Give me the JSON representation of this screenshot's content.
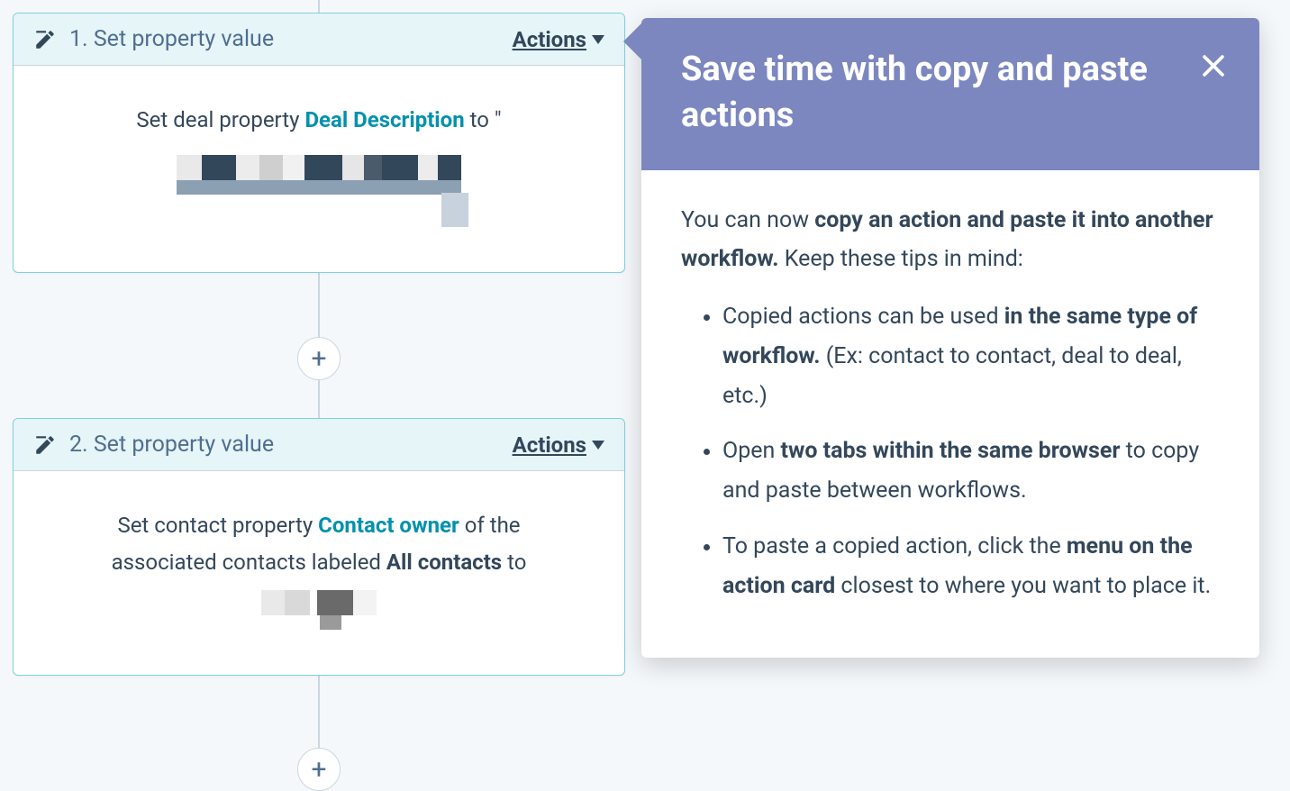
{
  "card1": {
    "number": "1",
    "title": "1. Set property value",
    "actions_label": "Actions",
    "body_prefix": "Set deal property ",
    "property_name": "Deal Description",
    "body_suffix": " to \""
  },
  "card2": {
    "number": "2",
    "title": "2. Set property value",
    "actions_label": "Actions",
    "line1_prefix": "Set contact property ",
    "property_name": "Contact owner",
    "line1_suffix": " of the",
    "line2_prefix": "associated contacts labeled ",
    "label_name": "All contacts",
    "line2_suffix": " to"
  },
  "plus_label": "+",
  "popover": {
    "title": "Save time with copy and paste actions",
    "intro_prefix": "You can now ",
    "intro_bold": "copy an action and paste it into another workflow.",
    "intro_suffix": " Keep these tips in mind:",
    "bullets": [
      {
        "pre": "Copied actions can be used ",
        "bold": "in the same type of workflow.",
        "post": " (Ex: contact to contact, deal to deal, etc.)"
      },
      {
        "pre": "Open ",
        "bold": "two tabs within the same browser",
        "post": " to copy and paste between workflows."
      },
      {
        "pre": "To paste a copied action, click the ",
        "bold": "menu on the action card",
        "post": " closest to where you want to place it."
      }
    ]
  }
}
